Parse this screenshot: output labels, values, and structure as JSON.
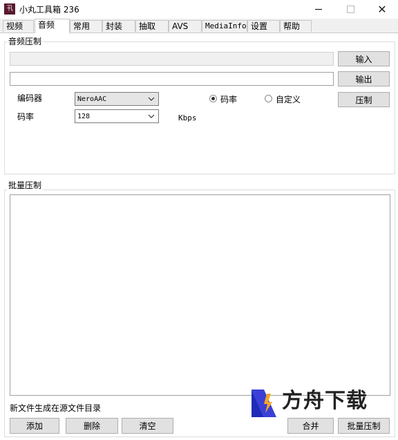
{
  "window": {
    "icon_text": "卂",
    "title": "小丸工具箱 236",
    "close_glyph": "✕"
  },
  "tabs": [
    {
      "label": "视频"
    },
    {
      "label": "音频",
      "active": true
    },
    {
      "label": "常用"
    },
    {
      "label": "封装"
    },
    {
      "label": "抽取"
    },
    {
      "label": "AVS"
    },
    {
      "label": "MediaInfo"
    },
    {
      "label": "设置"
    },
    {
      "label": "帮助"
    }
  ],
  "audio_compress": {
    "group_label": "音频压制",
    "input_value": "",
    "output_value": "",
    "input_button": "输入",
    "output_button": "输出",
    "encoder_label": "编码器",
    "encoder_value": "NeroAAC",
    "bitrate_label": "码率",
    "bitrate_value": "128",
    "bitrate_unit": "Kbps",
    "mode_bitrate_label": "码率",
    "mode_custom_label": "自定义",
    "mode_selected": "码率",
    "compress_button": "压制"
  },
  "batch": {
    "group_label": "批量压制",
    "files": [],
    "note": "新文件生成在源文件目录",
    "add_button": "添加",
    "delete_button": "删除",
    "clear_button": "清空",
    "merge_button": "合并",
    "batch_button": "批量压制"
  },
  "watermark": {
    "text": "方舟下载",
    "accent_color": "#f5a623",
    "primary_color": "#3b3fd6"
  }
}
